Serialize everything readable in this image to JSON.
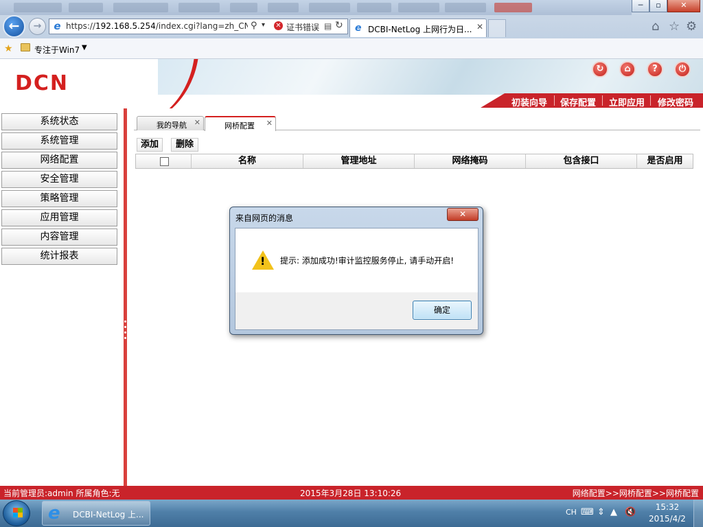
{
  "browser": {
    "url_prefix": "https://",
    "url_host": "192.168.5.254",
    "url_rest": "/index.cgi?lang=zh_CN,U",
    "cert_error": "证书错误",
    "tab_title": "DCBI-NetLog 上网行为日...",
    "tab_close": "✕",
    "favorites_item": "专注于Win7",
    "favorites_caret": "▼",
    "back_glyph": "←",
    "forward_glyph": "→",
    "win_min": "─",
    "win_max": "▫",
    "win_close": "✕",
    "icons": [
      "back-icon",
      "forward-icon",
      "search-icon",
      "certificate-error-icon",
      "refresh-icon",
      "home-icon",
      "favorites-star-icon",
      "settings-gear-icon"
    ]
  },
  "header": {
    "logo": "DCN",
    "icons": [
      "refresh-icon",
      "home-icon",
      "help-icon",
      "logout-icon"
    ],
    "icon_glyphs": [
      "↻",
      "⌂",
      "?",
      "⏻"
    ],
    "menu": [
      "初装向导",
      "保存配置",
      "立即应用",
      "修改密码"
    ]
  },
  "sidebar": {
    "items": [
      "系统状态",
      "系统管理",
      "网络配置",
      "安全管理",
      "策略管理",
      "应用管理",
      "内容管理",
      "统计报表"
    ]
  },
  "content": {
    "tabs": [
      {
        "label": "我的导航",
        "close": "✕",
        "active": false
      },
      {
        "label": "网桥配置",
        "close": "✕",
        "active": true
      }
    ],
    "toolbar": {
      "add": "添加",
      "delete": "删除"
    },
    "columns": [
      "名称",
      "管理地址",
      "网络掩码",
      "包含接口",
      "是否启用"
    ]
  },
  "dialog": {
    "title": "来自网页的消息",
    "close": "✕",
    "warn_mark": "!",
    "message": "提示: 添加成功!审计监控服务停止, 请手动开启!",
    "ok": "确定"
  },
  "statusbar": {
    "admin_info": "当前管理员:admin  所属角色:无",
    "datetime": "2015年3月28日 13:10:26",
    "path": "网络配置>>网桥配置>>网桥配置"
  },
  "taskbar": {
    "task_label": "DCBI-NetLog 上...",
    "lang": "CH",
    "time": "15:32",
    "date": "2015/4/2"
  },
  "colors": {
    "brand_red": "#c9232a",
    "logo_red": "#d4201f",
    "dialog_ok_border": "#3c7fb1"
  }
}
